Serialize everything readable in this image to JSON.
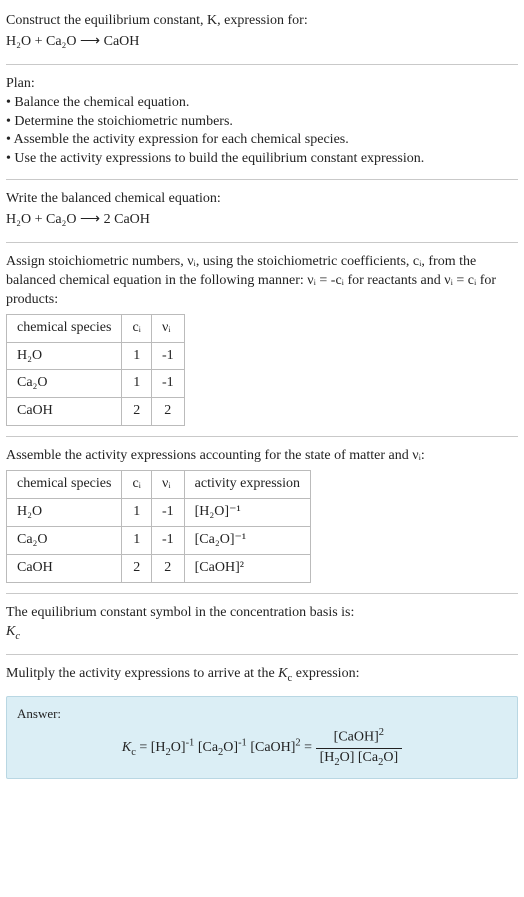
{
  "intro": {
    "line1": "Construct the equilibrium constant, K, expression for:",
    "eq": "H₂O + Ca₂O ⟶ CaOH"
  },
  "plan": {
    "heading": "Plan:",
    "b1": "• Balance the chemical equation.",
    "b2": "• Determine the stoichiometric numbers.",
    "b3": "• Assemble the activity expression for each chemical species.",
    "b4": "• Use the activity expressions to build the equilibrium constant expression."
  },
  "balanced": {
    "heading": "Write the balanced chemical equation:",
    "eq": "H₂O + Ca₂O ⟶ 2 CaOH"
  },
  "stoich": {
    "heading": "Assign stoichiometric numbers, νᵢ, using the stoichiometric coefficients, cᵢ, from the balanced chemical equation in the following manner: νᵢ = -cᵢ for reactants and νᵢ = cᵢ for products:",
    "h1": "chemical species",
    "h2": "cᵢ",
    "h3": "νᵢ",
    "rows": [
      {
        "sp": "H₂O",
        "c": "1",
        "v": "-1"
      },
      {
        "sp": "Ca₂O",
        "c": "1",
        "v": "-1"
      },
      {
        "sp": "CaOH",
        "c": "2",
        "v": "2"
      }
    ]
  },
  "activity": {
    "heading": "Assemble the activity expressions accounting for the state of matter and νᵢ:",
    "h1": "chemical species",
    "h2": "cᵢ",
    "h3": "νᵢ",
    "h4": "activity expression",
    "rows": [
      {
        "sp": "H₂O",
        "c": "1",
        "v": "-1",
        "a": "[H₂O]⁻¹"
      },
      {
        "sp": "Ca₂O",
        "c": "1",
        "v": "-1",
        "a": "[Ca₂O]⁻¹"
      },
      {
        "sp": "CaOH",
        "c": "2",
        "v": "2",
        "a": "[CaOH]²"
      }
    ]
  },
  "symbol": {
    "heading": "The equilibrium constant symbol in the concentration basis is:",
    "val": "K_c"
  },
  "multiply": {
    "heading": "Mulitply the activity expressions to arrive at the K_c expression:"
  },
  "answer": {
    "label": "Answer:",
    "lhs": "K_c = [H₂O]⁻¹ [Ca₂O]⁻¹ [CaOH]² = ",
    "num": "[CaOH]²",
    "den": "[H₂O] [Ca₂O]"
  },
  "chart_data": {
    "type": "table",
    "tables": [
      {
        "title": "stoichiometric numbers",
        "columns": [
          "chemical species",
          "c_i",
          "nu_i"
        ],
        "rows": [
          [
            "H2O",
            1,
            -1
          ],
          [
            "Ca2O",
            1,
            -1
          ],
          [
            "CaOH",
            2,
            2
          ]
        ]
      },
      {
        "title": "activity expressions",
        "columns": [
          "chemical species",
          "c_i",
          "nu_i",
          "activity expression"
        ],
        "rows": [
          [
            "H2O",
            1,
            -1,
            "[H2O]^-1"
          ],
          [
            "Ca2O",
            1,
            -1,
            "[Ca2O]^-1"
          ],
          [
            "CaOH",
            2,
            2,
            "[CaOH]^2"
          ]
        ]
      }
    ]
  }
}
